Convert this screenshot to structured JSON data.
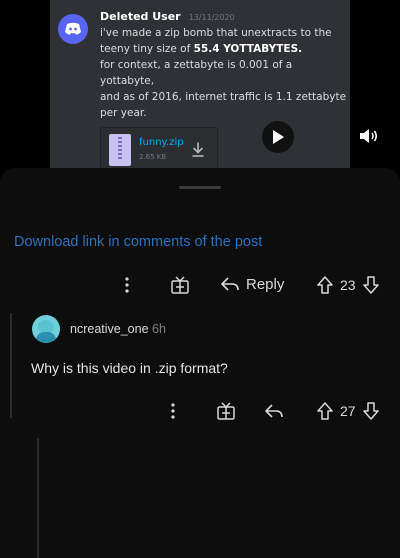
{
  "video": {
    "message": {
      "username": "Deleted User",
      "timestamp": "13/11/2020",
      "line1": "i've made a zip bomb that unextracts to the",
      "line2_prefix": "teeny tiny size of ",
      "line2_bold": "55.4 YOTTABYTES.",
      "line3": "for context, a zettabyte is 0.001 of a yottabyte,",
      "line4": "and as of 2016, internet traffic is 1.1 zettabyte",
      "line5": "per year."
    },
    "attachment": {
      "filename": "funny.zip",
      "size": "2.65 KB",
      "icon": "zip-file-icon"
    },
    "controls": {
      "play_icon": "play-icon",
      "volume_icon": "volume-icon"
    }
  },
  "post_comment": {
    "text": "Download link in comments of the post",
    "link_color": "#2a73c2",
    "actions": {
      "more_icon": "more-icon",
      "award_icon": "award-icon",
      "reply_label": "Reply",
      "score": "23"
    }
  },
  "reply_comment": {
    "username": "ncreative_one",
    "age": "6h",
    "text": "Why is this video in .zip format?",
    "actions": {
      "more_icon": "more-icon",
      "award_icon": "award-icon",
      "reply_icon": "reply-arrow-icon",
      "score": "27"
    }
  },
  "colors": {
    "background": "#000000",
    "sheet": "#0d0d0d",
    "discord_blurple": "#5865f2"
  }
}
